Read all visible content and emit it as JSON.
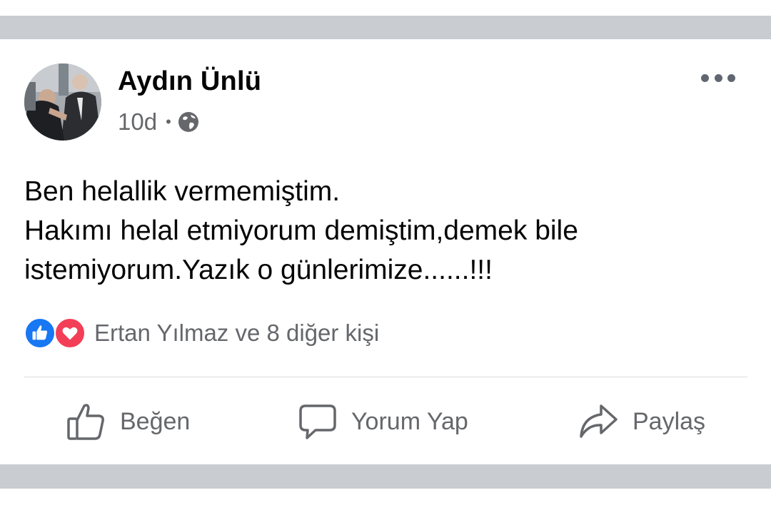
{
  "post": {
    "author": "Aydın Ünlü",
    "time": "10d",
    "separator": "•",
    "privacy_icon": "globe-icon",
    "more_icon": "more-options-icon",
    "text_lines": [
      "Ben helallik vermemiştim.",
      "Hakımı helal etmiyorum demiştim,demek bile",
      "istemiyorum.Yazık o günlerimize......!!!"
    ],
    "reactions": {
      "icons": [
        "like-reaction-icon",
        "love-reaction-icon"
      ],
      "text": "Ertan Yılmaz ve 8 diğer kişi"
    },
    "actions": {
      "like": "Beğen",
      "comment": "Yorum Yap",
      "share": "Paylaş"
    }
  },
  "colors": {
    "band": "#c9ccd1",
    "like_blue": "#1877f2",
    "love_red": "#f33e58",
    "secondary_text": "#65676b"
  }
}
